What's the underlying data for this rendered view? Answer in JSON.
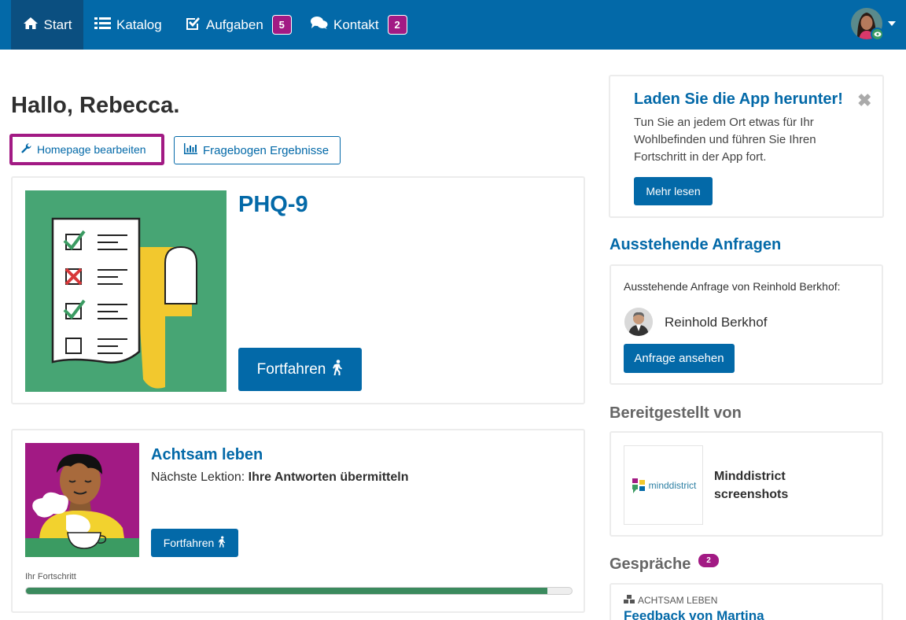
{
  "nav": {
    "items": [
      {
        "label": "Start",
        "icon": "home-icon"
      },
      {
        "label": "Katalog",
        "icon": "list-icon"
      },
      {
        "label": "Aufgaben",
        "icon": "check-square-icon",
        "badge": "5"
      },
      {
        "label": "Kontakt",
        "icon": "comments-icon",
        "badge": "2"
      }
    ],
    "colors": {
      "bar": "#0369a8",
      "active": "#0b4f80",
      "badge": "#a21a84"
    }
  },
  "greeting": "Hallo, Rebecca.",
  "actions": {
    "edit_label": "Homepage bearbeiten",
    "results_label": "Fragebogen Ergebnisse"
  },
  "phq": {
    "title": "PHQ-9",
    "button_label": "Fortfahren"
  },
  "mindful": {
    "title": "Achtsam leben",
    "next_prefix": "Nächste Lektion:",
    "next_lesson": "Ihre Antworten übermitteln",
    "button_label": "Fortfahren",
    "progress_label": "Ihr Fortschritt",
    "progress": 0.955
  },
  "app_promo": {
    "title": "Laden Sie die App herunter!",
    "close": "✖",
    "text": "Tun Sie an jedem Ort etwas für Ihr Wohlbefinden und führen Sie Ihren Fortschritt in der App fort.",
    "button_label": "Mehr lesen"
  },
  "requests": {
    "heading": "Ausstehende Anfragen",
    "text": "Ausstehende Anfrage von Reinhold Berkhof:",
    "name": "Reinhold Berkhof",
    "button_label": "Anfrage ansehen"
  },
  "provider": {
    "heading": "Bereitgestellt von",
    "logo_text": "minddistrict",
    "name_line1": "Minddistrict",
    "name_line2": "screenshots"
  },
  "conversations": {
    "heading": "Gespräche",
    "badge": "2",
    "tag": "Achtsam leben",
    "title": "Feedback von Martina"
  }
}
